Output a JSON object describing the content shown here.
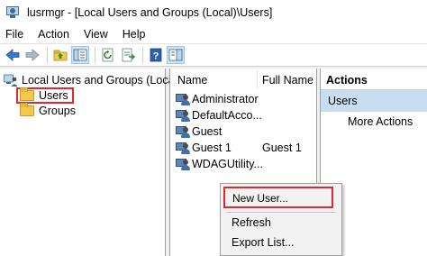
{
  "window": {
    "title": "lusrmgr - [Local Users and Groups (Local)\\Users]"
  },
  "menu": [
    "File",
    "Action",
    "View",
    "Help"
  ],
  "toolbar": {
    "icons": [
      "back-arrow-icon",
      "forward-arrow-icon",
      "up-folder-icon",
      "show-hide-tree-icon",
      "refresh-icon",
      "export-list-icon",
      "help-icon",
      "properties-icon"
    ]
  },
  "tree": {
    "root": "Local Users and Groups (Local)",
    "items": [
      {
        "label": "Users",
        "selected": true
      },
      {
        "label": "Groups",
        "selected": false
      }
    ]
  },
  "list": {
    "columns": [
      "Name",
      "Full Name"
    ],
    "rows": [
      {
        "name": "Administrator",
        "full_name": ""
      },
      {
        "name": "DefaultAcco...",
        "full_name": ""
      },
      {
        "name": "Guest",
        "full_name": ""
      },
      {
        "name": "Guest 1",
        "full_name": "Guest 1"
      },
      {
        "name": "WDAGUtility...",
        "full_name": ""
      }
    ]
  },
  "actions": {
    "header": "Actions",
    "section": "Users",
    "items": [
      "More Actions"
    ]
  },
  "context_menu": {
    "items": [
      "New User...",
      "Refresh",
      "Export List..."
    ]
  },
  "colors": {
    "highlight_border": "#e0262f",
    "actions_section_bg": "#c9ddf1"
  }
}
